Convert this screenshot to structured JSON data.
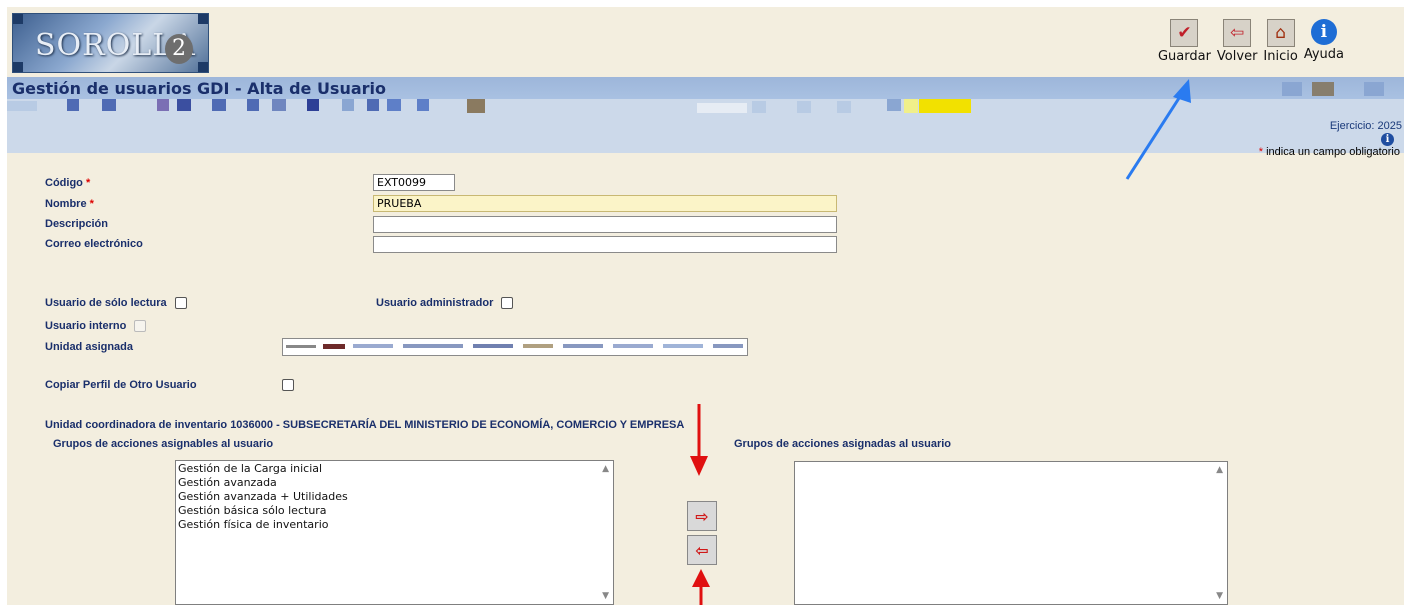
{
  "header": {
    "logo_text": "SOROLLA",
    "logo_suffix": "2",
    "title": "Gestión de usuarios GDI - Alta de Usuario",
    "ejercicio": "Ejercicio: 2025",
    "info_glyph": "i",
    "obligatorio_star": "*",
    "obligatorio_text": " indica un campo obligatorio"
  },
  "toolbar": {
    "items": [
      {
        "label": "Guardar",
        "icon": "save-check-icon",
        "glyph": "✔"
      },
      {
        "label": "Volver",
        "icon": "back-arrow-icon",
        "glyph": "⇦"
      },
      {
        "label": "Inicio",
        "icon": "home-icon",
        "glyph": "⌂"
      },
      {
        "label": "Ayuda",
        "icon": "info-icon",
        "glyph": "i"
      }
    ]
  },
  "form": {
    "codigo_label": "Código",
    "codigo_value": "EXT0099",
    "nombre_label": "Nombre",
    "nombre_value": "PRUEBA",
    "descripcion_label": "Descripción",
    "descripcion_value": "",
    "correo_label": "Correo electrónico",
    "correo_value": "",
    "required_star": "*",
    "solo_lectura_label": "Usuario de sólo lectura",
    "administrador_label": "Usuario administrador",
    "interno_label": "Usuario interno",
    "unidad_label": "Unidad asignada",
    "copiar_label": "Copiar Perfil de Otro Usuario"
  },
  "groups": {
    "section_title": "Unidad coordinadora de inventario 1036000 - SUBSECRETARÍA DEL MINISTERIO DE ECONOMÍA, COMERCIO Y EMPRESA",
    "asignables_label": "Grupos de acciones asignables al usuario",
    "asignadas_label": "Grupos de acciones asignadas al usuario",
    "asignables": [
      "Gestión de la Carga inicial",
      "Gestión avanzada",
      "Gestión avanzada + Utilidades",
      "Gestión básica sólo lectura",
      "Gestión física de inventario"
    ],
    "asignadas": [],
    "move_right_glyph": "⇨",
    "move_left_glyph": "⇦",
    "scroll_up_glyph": "▲",
    "scroll_down_glyph": "▼"
  },
  "colors": {
    "background": "#f3eedf",
    "title_bar": "#9db6da",
    "label_text": "#1a2f6b",
    "required": "#dd0000",
    "annotation_red": "#e01010",
    "annotation_blue": "#2a7bf0"
  }
}
